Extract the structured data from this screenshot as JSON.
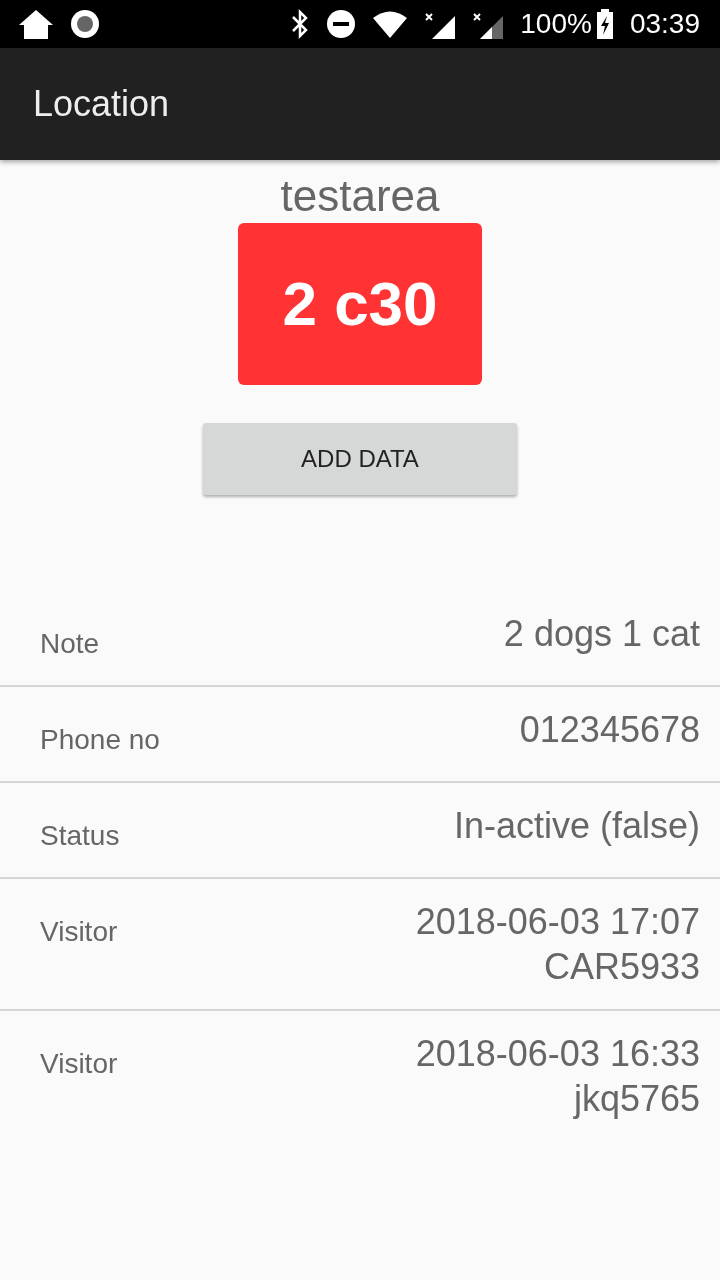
{
  "status_bar": {
    "battery": "100%",
    "time": "03:39"
  },
  "app_bar": {
    "title": "Location"
  },
  "area": {
    "name": "testarea",
    "code": "2 c30"
  },
  "add_button": {
    "label": "ADD DATA"
  },
  "details": [
    {
      "label": "Note",
      "values": [
        "2 dogs 1 cat"
      ]
    },
    {
      "label": "Phone no",
      "values": [
        "012345678"
      ]
    },
    {
      "label": "Status",
      "values": [
        "In-active (false)"
      ]
    },
    {
      "label": "Visitor",
      "values": [
        "2018-06-03 17:07",
        "CAR5933"
      ]
    },
    {
      "label": "Visitor",
      "values": [
        "2018-06-03 16:33",
        "jkq5765"
      ]
    }
  ]
}
